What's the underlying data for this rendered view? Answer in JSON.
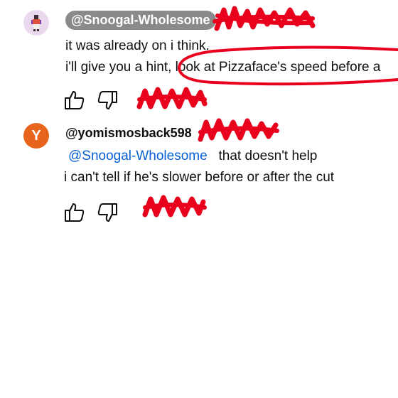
{
  "comments": [
    {
      "author": "@Snoogal-Wholesome",
      "lines": [
        "it was already on i think.",
        "i'll give you a hint, look at Pizzaface's speed before a"
      ],
      "avatar_icon": "pixel-character-avatar-icon"
    },
    {
      "author": "@yomismosback598",
      "avatar_letter": "Y",
      "mention": "@Snoogal-Wholesome",
      "line1_rest": "that doesn't help",
      "line2": "i can't tell if he's slower before or after the cut"
    }
  ],
  "icons": {
    "like": "thumbs-up-icon",
    "dislike": "thumbs-down-icon"
  },
  "colors": {
    "author_pill_bg": "#8a8a8a",
    "mention": "#065fd4",
    "avatar_y": "#e8641c",
    "marker_red": "#e8001c"
  }
}
